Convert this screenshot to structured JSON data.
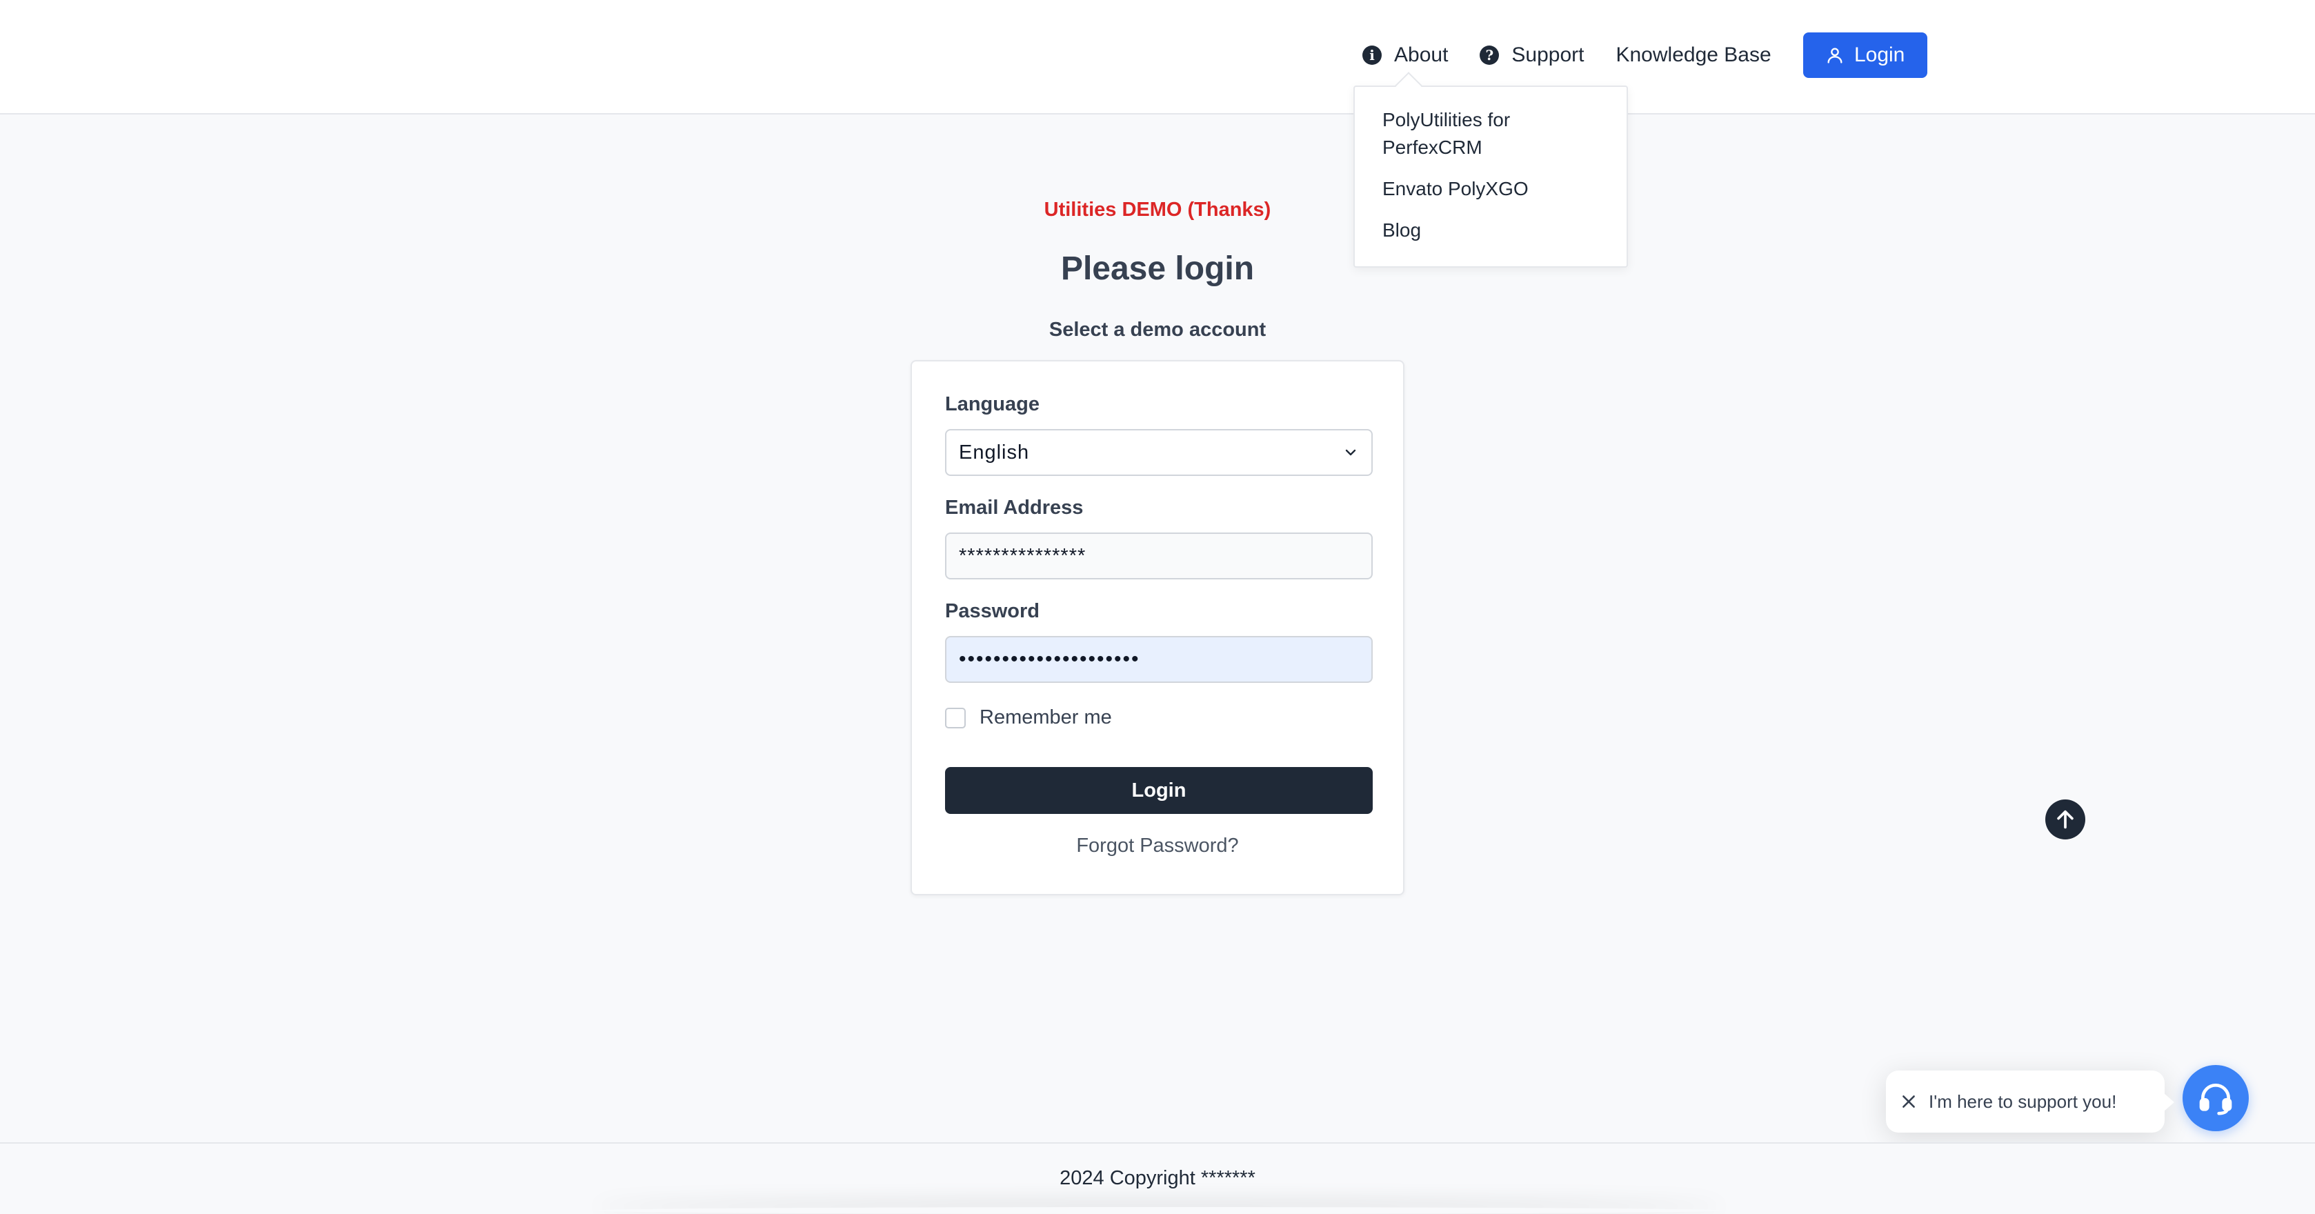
{
  "header": {
    "nav": {
      "about": "About",
      "support": "Support",
      "knowledge_base": "Knowledge Base",
      "login": "Login"
    },
    "about_menu": {
      "items": [
        "PolyUtilities for PerfexCRM",
        "Envato PolyXGO",
        "Blog"
      ]
    },
    "accent_color": "#2563eb"
  },
  "main": {
    "demo_tag": "Utilities DEMO (Thanks)",
    "title": "Please login",
    "subtitle": "Select a demo account"
  },
  "form": {
    "language_label": "Language",
    "language_value": "English",
    "email_label": "Email Address",
    "email_value": "***************",
    "password_label": "Password",
    "password_value": "•••••••••••••••••••••",
    "remember_label": "Remember me",
    "submit_label": "Login",
    "forgot_label": "Forgot Password?"
  },
  "chat": {
    "message": "I'm here to support you!",
    "launcher_color": "#3b82f6"
  },
  "footer": {
    "text": "2024 Copyright *******"
  }
}
